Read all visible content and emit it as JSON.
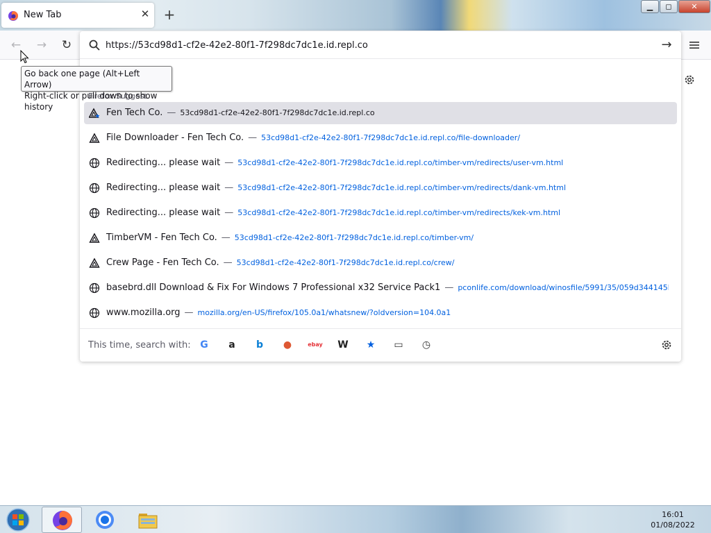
{
  "tab": {
    "title": "New Tab",
    "close_glyph": "✕",
    "new_tab_glyph": "+"
  },
  "window_controls": {
    "minimize": "▁",
    "maximize": "◻",
    "close": "✕"
  },
  "nav": {
    "back_glyph": "←",
    "forward_glyph": "→",
    "reload_glyph": "↻"
  },
  "urlbar": {
    "value": "https://53cd98d1-cf2e-42e2-80f1-7f298dc7dc1e.id.repl.co",
    "go_glyph": "→"
  },
  "tooltip": {
    "line1": "Go back one page (Alt+Left Arrow)",
    "line2": "Right-click or pull down to show history"
  },
  "suggest_heading": "Firefox Suggest",
  "results": [
    {
      "icon": "replit-bookmark-icon",
      "title": "Fen Tech Co.",
      "url": "53cd98d1-cf2e-42e2-80f1-7f298dc7dc1e.id.repl.co",
      "selected": true
    },
    {
      "icon": "replit-icon",
      "title": "File Downloader - Fen Tech Co.",
      "url": "53cd98d1-cf2e-42e2-80f1-7f298dc7dc1e.id.repl.co/file-downloader/"
    },
    {
      "icon": "globe-icon",
      "title": "Redirecting... please wait",
      "url": "53cd98d1-cf2e-42e2-80f1-7f298dc7dc1e.id.repl.co/timber-vm/redirects/user-vm.html"
    },
    {
      "icon": "globe-icon",
      "title": "Redirecting... please wait",
      "url": "53cd98d1-cf2e-42e2-80f1-7f298dc7dc1e.id.repl.co/timber-vm/redirects/dank-vm.html"
    },
    {
      "icon": "globe-icon",
      "title": "Redirecting... please wait",
      "url": "53cd98d1-cf2e-42e2-80f1-7f298dc7dc1e.id.repl.co/timber-vm/redirects/kek-vm.html"
    },
    {
      "icon": "replit-icon",
      "title": "TimberVM - Fen Tech Co.",
      "url": "53cd98d1-cf2e-42e2-80f1-7f298dc7dc1e.id.repl.co/timber-vm/"
    },
    {
      "icon": "replit-icon",
      "title": "Crew Page - Fen Tech Co.",
      "url": "53cd98d1-cf2e-42e2-80f1-7f298dc7dc1e.id.repl.co/crew/"
    },
    {
      "icon": "globe-icon",
      "title": "basebrd.dll Download & Fix For Windows 7 Professional x32 Service Pack1",
      "url": "pconlife.com/download/winosfile/5991/35/059d344145ba1031"
    },
    {
      "icon": "globe-icon",
      "title": "www.mozilla.org",
      "url": "mozilla.org/en-US/firefox/105.0a1/whatsnew/?oldversion=104.0a1"
    }
  ],
  "dash": "—",
  "one_off": {
    "label": "This time, search with:",
    "engines": [
      {
        "name": "google-icon",
        "glyph": "G",
        "color": "#4285f4"
      },
      {
        "name": "amazon-icon",
        "glyph": "a",
        "color": "#222222"
      },
      {
        "name": "bing-icon",
        "glyph": "b",
        "color": "#0a7fd5"
      },
      {
        "name": "duckduckgo-icon",
        "glyph": "●",
        "color": "#de5833"
      },
      {
        "name": "ebay-icon",
        "glyph": "ebay",
        "color": "#e53238"
      },
      {
        "name": "wikipedia-icon",
        "glyph": "W",
        "color": "#222222"
      },
      {
        "name": "bookmarks-icon",
        "glyph": "★",
        "color": "#0060df"
      },
      {
        "name": "tabs-icon",
        "glyph": "▭",
        "color": "#333333"
      },
      {
        "name": "history-icon",
        "glyph": "◷",
        "color": "#333333"
      }
    ]
  },
  "taskbar": {
    "time": "16:01",
    "date": "01/08/2022"
  }
}
